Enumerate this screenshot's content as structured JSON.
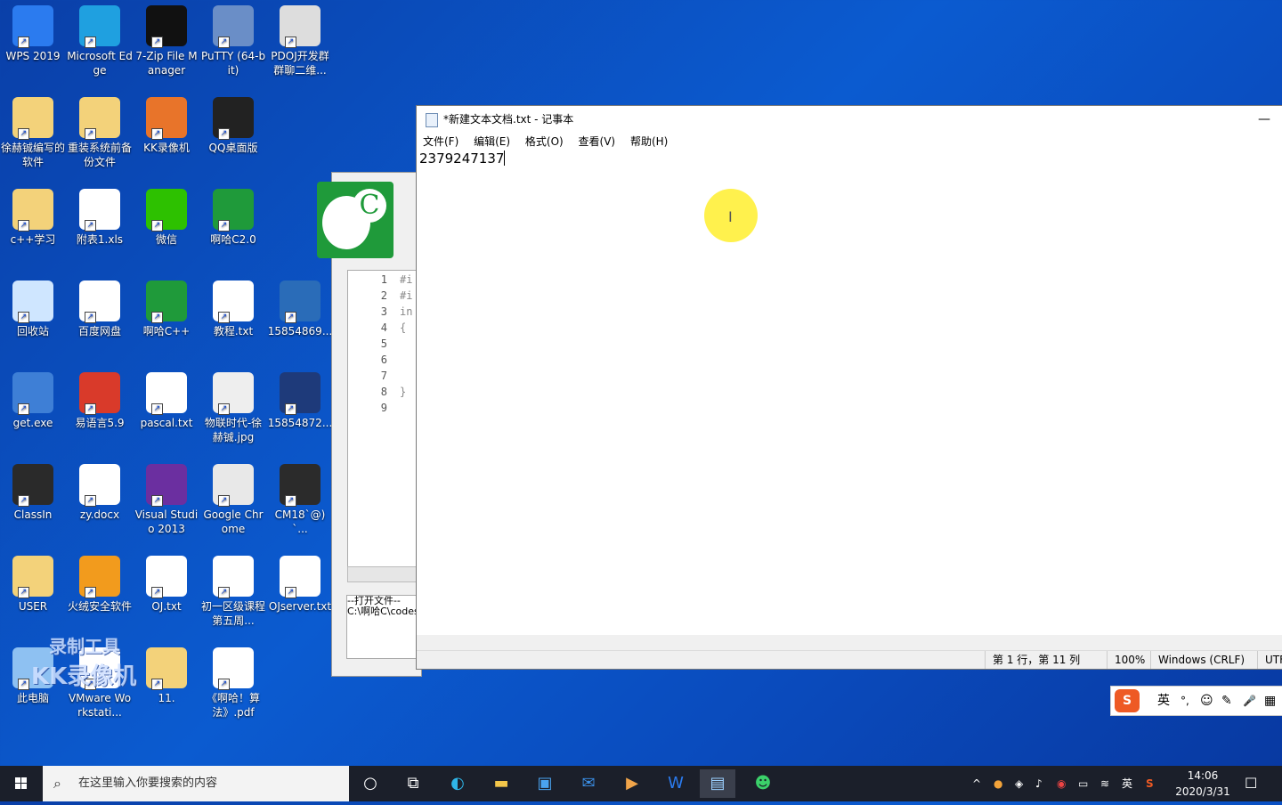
{
  "desktop": {
    "icons": [
      {
        "label": "WPS 2019",
        "color": "#2b7bef"
      },
      {
        "label": "Microsoft Edge",
        "color": "#1fa0e0"
      },
      {
        "label": "7-Zip File Manager",
        "color": "#111111"
      },
      {
        "label": "PuTTY (64-bit)",
        "color": "#6a8ec7"
      },
      {
        "label": "PDOJ开发群群聊二维...",
        "color": "#dddddd"
      },
      {
        "label": "徐赫铖编写的软件",
        "color": "#f3d27a"
      },
      {
        "label": "重装系统前备份文件",
        "color": "#f3d27a"
      },
      {
        "label": "KK录像机",
        "color": "#e8742a"
      },
      {
        "label": "QQ桌面版",
        "color": "#222222"
      },
      {
        "label": "c++学习",
        "color": "#f3d27a"
      },
      {
        "label": "附表1.xls",
        "color": "#ffffff"
      },
      {
        "label": "微信",
        "color": "#2dc100"
      },
      {
        "label": "啊哈C2.0",
        "color": "#1f9a3a"
      },
      {
        "label": "回收站",
        "color": "#cfe6ff"
      },
      {
        "label": "百度网盘",
        "color": "#ffffff"
      },
      {
        "label": "啊哈C++",
        "color": "#1f9a3a"
      },
      {
        "label": "教程.txt",
        "color": "#ffffff"
      },
      {
        "label": "15854869...",
        "color": "#2a6cb8"
      },
      {
        "label": "get.exe",
        "color": "#3e7fd6"
      },
      {
        "label": "易语言5.9",
        "color": "#d93a2a"
      },
      {
        "label": "pascal.txt",
        "color": "#ffffff"
      },
      {
        "label": "物联时代-徐赫铖.jpg",
        "color": "#eeeeee"
      },
      {
        "label": "15854872...",
        "color": "#1e3a7a"
      },
      {
        "label": "ClassIn",
        "color": "#2a2a2a"
      },
      {
        "label": "zy.docx",
        "color": "#ffffff"
      },
      {
        "label": "Visual Studio 2013",
        "color": "#6b2fa0"
      },
      {
        "label": "Google Chrome",
        "color": "#e8e8e8"
      },
      {
        "label": "CM18`@)`...",
        "color": "#2b2b2b"
      },
      {
        "label": "USER",
        "color": "#f3d27a"
      },
      {
        "label": "火绒安全软件",
        "color": "#f29b1d"
      },
      {
        "label": "OJ.txt",
        "color": "#ffffff"
      },
      {
        "label": "初一区级课程第五周...",
        "color": "#ffffff"
      },
      {
        "label": "OJserver.txt",
        "color": "#ffffff"
      },
      {
        "label": "此电脑",
        "color": "#8ec1f2"
      },
      {
        "label": "VMware Workstati...",
        "color": "#ffffff"
      },
      {
        "label": "11.",
        "color": "#f3d27a"
      },
      {
        "label": "《啊哈！算法》.pdf",
        "color": "#ffffff"
      }
    ]
  },
  "aha": {
    "line_numbers": [
      "1",
      "2",
      "3",
      "4",
      "5",
      "6",
      "7",
      "8",
      "9"
    ],
    "code_lines": [
      "#i",
      "#i",
      "in",
      "{",
      "",
      "",
      "",
      "}",
      ""
    ],
    "open_label": "--打开文件--",
    "open_path": "C:\\啊哈C\\codes"
  },
  "notepad": {
    "title": "*新建文本文档.txt - 记事本",
    "minimize": "—",
    "menu": [
      "文件(F)",
      "编辑(E)",
      "格式(O)",
      "查看(V)",
      "帮助(H)"
    ],
    "content": "2379247137",
    "status": {
      "position": "第 1 行，第 11 列",
      "zoom": "100%",
      "eol": "Windows (CRLF)",
      "encoding": "UTF"
    }
  },
  "watermark": {
    "line1": "录制工具",
    "line2": "KK录像机"
  },
  "ime": {
    "logo": "S",
    "lang": "英",
    "items": [
      "°,",
      "☺",
      "✎",
      "🎤",
      "▦"
    ]
  },
  "taskbar": {
    "search_placeholder": "在这里输入你要搜索的内容",
    "tray_lang": "英",
    "time": "14:06",
    "date": "2020/3/31"
  },
  "colors": {
    "desktop_blue": "#0b5bd0",
    "taskbar": "#1b1f2a",
    "aha_green": "#1f9a3a",
    "cursor_highlight": "#ffef3a"
  }
}
